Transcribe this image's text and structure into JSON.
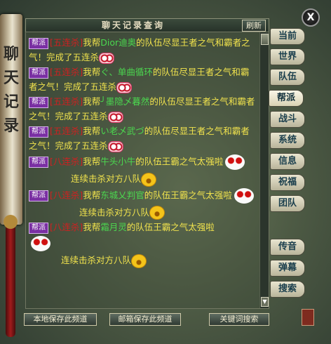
{
  "window": {
    "title": "聊天记录查询",
    "refresh_label": "刷新",
    "close_label": "X",
    "side_scroll_text": "聊天记录"
  },
  "channels": [
    {
      "label": "当前"
    },
    {
      "label": "世界"
    },
    {
      "label": "队伍"
    },
    {
      "label": "帮派"
    },
    {
      "label": "战斗"
    },
    {
      "label": "系统"
    },
    {
      "label": "信息"
    },
    {
      "label": "祝福"
    },
    {
      "label": "团队"
    },
    {
      "label": "传音"
    },
    {
      "label": "弹幕"
    },
    {
      "label": "搜索"
    }
  ],
  "active_channel": "帮派",
  "messages": [
    {
      "badge": "帮派",
      "tag": "[五连杀]",
      "pre": "我帮",
      "name": "Dior迪奥",
      "post": "的队伍尽显王者之气和霸者之气！完成了五连杀"
    },
    {
      "badge": "帮派",
      "tag": "[五连杀]",
      "pre": "我帮",
      "name": "ぐ、单曲循环",
      "post": "的队伍尽显王者之气和霸者之气！完成了五连杀"
    },
    {
      "badge": "帮派",
      "tag": "[五连杀]",
      "pre": "我帮",
      "name": "╯墨隐乄暮然",
      "post": "的队伍尽显王者之气和霸者之气！完成了五连杀"
    },
    {
      "badge": "帮派",
      "tag": "[五连杀]",
      "pre": "我帮",
      "name": "い老乄武づ",
      "post": "的队伍尽显王者之气和霸者之气！完成了五连杀"
    },
    {
      "badge": "帮派",
      "tag": "[八连杀]",
      "pre": "我帮",
      "name": "牛头小牛",
      "post": "的队伍王霸之气太强啦",
      "extra": "连续击杀对方八队"
    },
    {
      "badge": "帮派",
      "tag": "[八连杀]",
      "pre": "我帮",
      "name": "东城乂判官",
      "post": "的队伍王霸之气太强啦",
      "extra": "连续击杀对方八队"
    },
    {
      "badge": "帮派",
      "tag": "[八连杀]",
      "pre": "我帮",
      "name": "霜月灵",
      "post": "的队伍王霸之气太强啦",
      "extra": "连续击杀对方八队"
    }
  ],
  "footer": {
    "save_local": "本地保存此频道",
    "save_mail": "邮箱保存此频道",
    "keyword_search": "关键词搜索"
  },
  "icons": {
    "close": "close-icon",
    "scroll_down": "chevron-down-icon"
  },
  "colors": {
    "message_text": "#f1e34d",
    "kill_tag": "#d02020",
    "player_name": "#4bd84f",
    "badge_bg": "#7a2fa3"
  }
}
